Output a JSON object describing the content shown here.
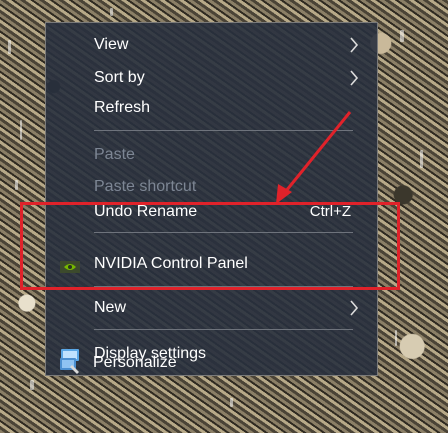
{
  "menu": {
    "items": [
      {
        "label": "View",
        "submenu": true
      },
      {
        "label": "Sort by",
        "submenu": true
      },
      {
        "label": "Refresh"
      },
      {
        "label": "Paste",
        "disabled": true
      },
      {
        "label": "Paste shortcut",
        "disabled": true
      },
      {
        "label": "Undo Rename",
        "shortcut": "Ctrl+Z"
      },
      {
        "label": "NVIDIA Control Panel",
        "icon": "nvidia-icon"
      },
      {
        "label": "New",
        "submenu": true
      },
      {
        "label": "Display settings",
        "icon": "display-settings-icon"
      },
      {
        "label": "Personalize",
        "icon": "personalize-icon"
      }
    ],
    "submenu_glyph": "❯"
  },
  "annotation": {
    "color": "#e0222a"
  }
}
